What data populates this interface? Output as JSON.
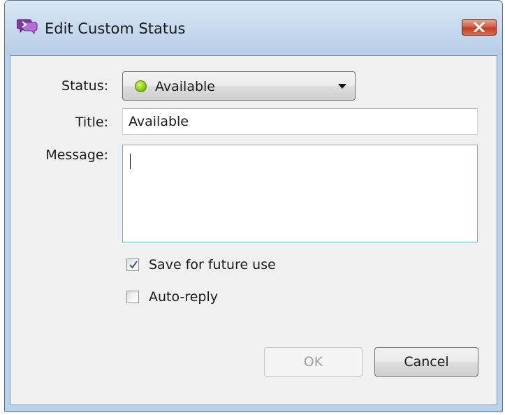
{
  "window": {
    "title": "Edit Custom Status"
  },
  "form": {
    "status_label": "Status:",
    "status_value": "Available",
    "title_label": "Title:",
    "title_value": "Available",
    "message_label": "Message:",
    "message_value": ""
  },
  "options": {
    "save_label": "Save for future use",
    "save_checked": true,
    "autoreply_label": "Auto-reply",
    "autoreply_checked": false
  },
  "buttons": {
    "ok_label": "OK",
    "ok_enabled": false,
    "cancel_label": "Cancel"
  },
  "colors": {
    "status_available": "#8ccd1c",
    "close_button": "#c13f26"
  },
  "icons": {
    "app": "chat-bubbles-icon",
    "close": "close-icon",
    "status": "status-available-dot-icon",
    "dropdown": "chevron-down-icon",
    "check": "checkmark-icon"
  }
}
